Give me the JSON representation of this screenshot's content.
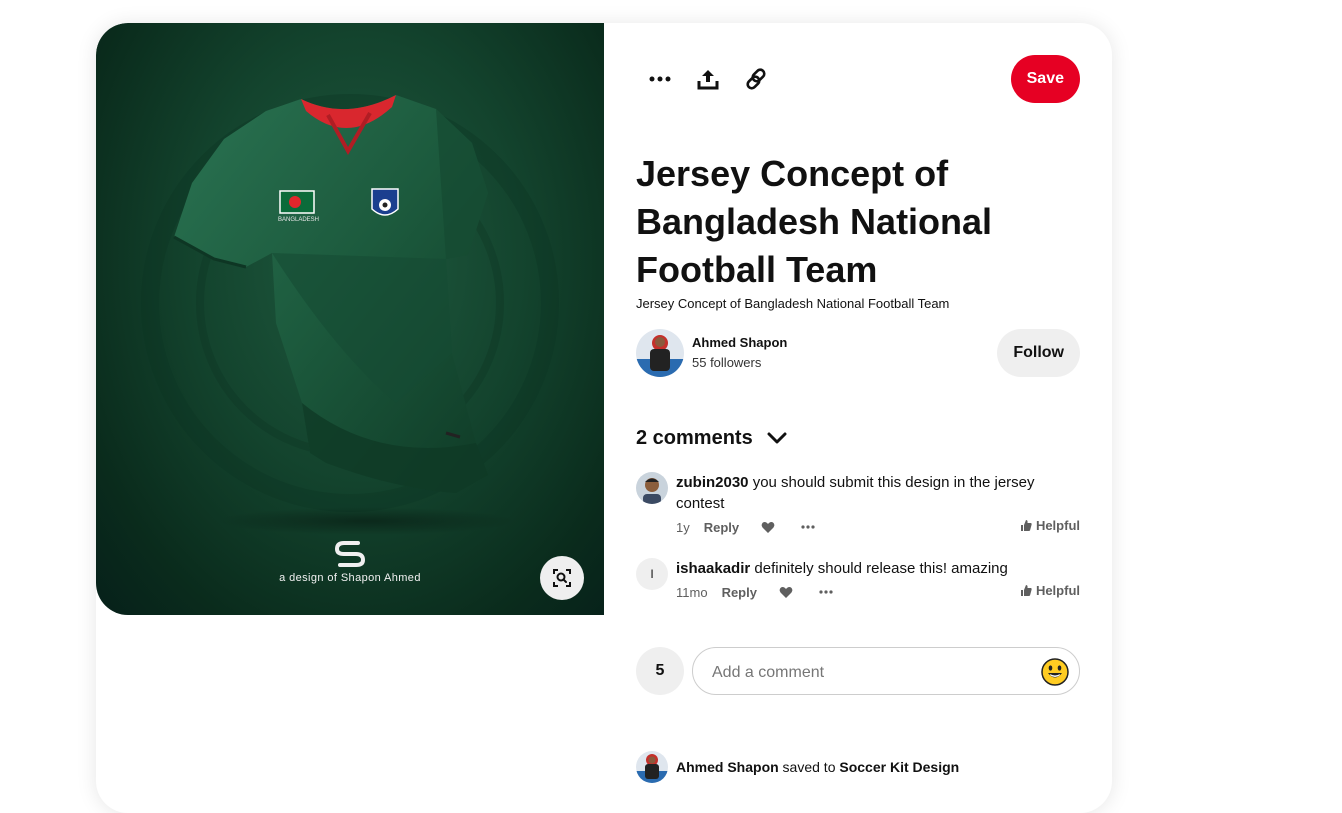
{
  "pin": {
    "title": "Jersey Concept of Bangladesh National Football Team",
    "description": "Jersey Concept of Bangladesh National Football Team",
    "image": {
      "brand_caption": "a design of Shapon Ahmed",
      "flag_label": "BANGLADESH",
      "colors": {
        "background": "#0f3d2a",
        "jersey": "#1e5f40",
        "collar": "#d9272e"
      }
    }
  },
  "toolbar": {
    "more_icon": "more-dots-icon",
    "share_icon": "share-upload-icon",
    "link_icon": "link-icon",
    "save_label": "Save",
    "save_color": "#e60023"
  },
  "author": {
    "name": "Ahmed Shapon",
    "followers": "55 followers",
    "follow_label": "Follow"
  },
  "comments": {
    "header": "2 comments",
    "items": [
      {
        "user": "zubin2030",
        "text": "you should submit this design in the jersey contest",
        "time": "1y",
        "reply_label": "Reply",
        "helpful_label": "Helpful",
        "avatar": "photo"
      },
      {
        "user": "ishaakadir",
        "text": "definitely should release this! amazing",
        "time": "11mo",
        "reply_label": "Reply",
        "helpful_label": "Helpful",
        "avatar_letter": "I"
      }
    ]
  },
  "add_comment": {
    "reaction_count": "5",
    "placeholder": "Add a comment",
    "emoji_icon": "smiley-emoji-icon"
  },
  "saved_to": {
    "user": "Ahmed Shapon",
    "middle": " saved to ",
    "board": "Soccer Kit Design"
  }
}
